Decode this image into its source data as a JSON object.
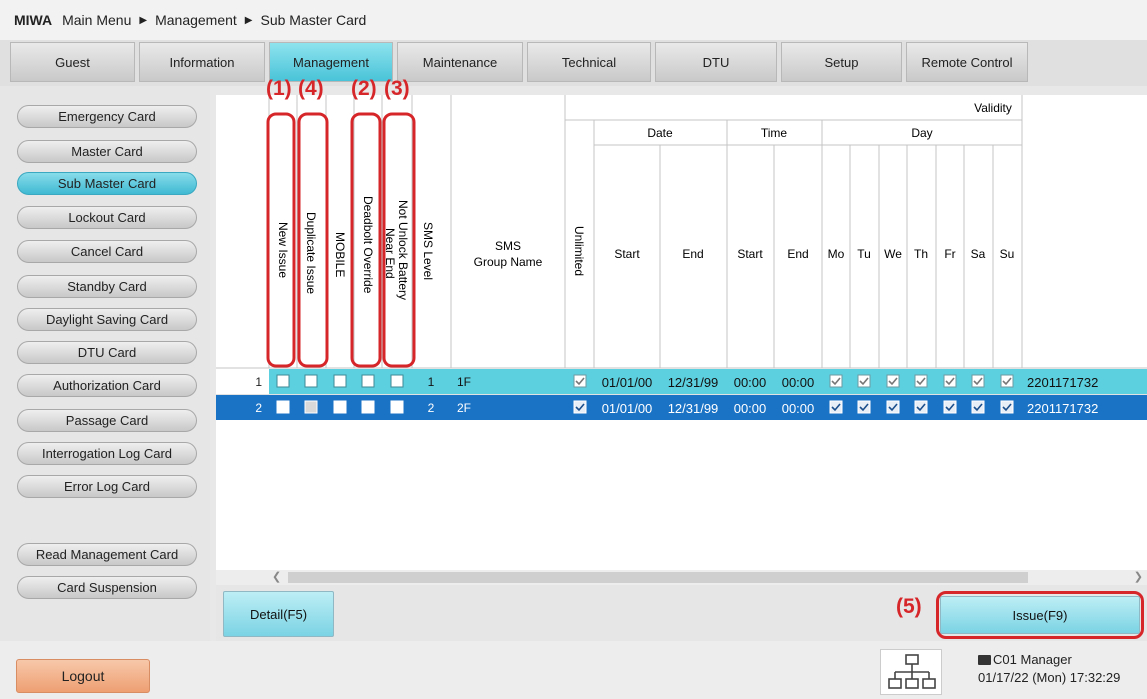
{
  "breadcrumb": {
    "brand": "MIWA",
    "items": [
      "Main Menu",
      "Management",
      "Sub Master Card"
    ]
  },
  "tabs": [
    {
      "label": "Guest",
      "active": false
    },
    {
      "label": "Information",
      "active": false
    },
    {
      "label": "Management",
      "active": true
    },
    {
      "label": "Maintenance",
      "active": false
    },
    {
      "label": "Technical",
      "active": false
    },
    {
      "label": "DTU",
      "active": false
    },
    {
      "label": "Setup",
      "active": false
    },
    {
      "label": "Remote Control",
      "active": false
    }
  ],
  "sidebar": {
    "items": [
      {
        "label": "Emergency Card",
        "active": false
      },
      {
        "label": "Master Card",
        "active": false
      },
      {
        "label": "Sub Master Card",
        "active": true
      },
      {
        "label": "Lockout Card",
        "active": false
      },
      {
        "label": "Cancel Card",
        "active": false
      },
      {
        "label": "Standby Card",
        "active": false
      },
      {
        "label": "Daylight Saving Card",
        "active": false
      },
      {
        "label": "DTU Card",
        "active": false
      },
      {
        "label": "Authorization Card",
        "active": false
      },
      {
        "label": "Passage Card",
        "active": false
      },
      {
        "label": "Interrogation Log Card",
        "active": false
      },
      {
        "label": "Error Log Card",
        "active": false
      },
      {
        "label": "Read Management Card",
        "active": false
      },
      {
        "label": "Card Suspension",
        "active": false
      }
    ]
  },
  "table": {
    "headers": {
      "new_issue": "New Issue",
      "duplicate_issue": "Duplicate Issue",
      "mobile": "MOBILE",
      "deadbolt_override": "Deadbolt Override",
      "not_unlock_battery": "Not Unlock Battery",
      "near_end": "Near End",
      "sms_level": "SMS Level",
      "sms_group_name_1": "SMS",
      "sms_group_name_2": "Group Name",
      "validity": "Validity",
      "unlimited": "Unlimited",
      "date": "Date",
      "time": "Time",
      "day": "Day",
      "start": "Start",
      "end": "End",
      "days": [
        "Mo",
        "Tu",
        "We",
        "Th",
        "Fr",
        "Sa",
        "Su"
      ]
    },
    "rows": [
      {
        "num": "1",
        "new_issue": false,
        "duplicate_issue": false,
        "mobile": false,
        "deadbolt_override": false,
        "not_unlock_battery": false,
        "level": "1",
        "group": "1F",
        "unlimited": true,
        "date_start": "01/01/00",
        "date_end": "12/31/99",
        "time_start": "00:00",
        "time_end": "00:00",
        "days": [
          true,
          true,
          true,
          true,
          true,
          true,
          true
        ],
        "id": "2201171732",
        "selected": false
      },
      {
        "num": "2",
        "new_issue": false,
        "duplicate_issue": false,
        "mobile": false,
        "deadbolt_override": false,
        "not_unlock_battery": false,
        "level": "2",
        "group": "2F",
        "unlimited": true,
        "date_start": "01/01/00",
        "date_end": "12/31/99",
        "time_start": "00:00",
        "time_end": "00:00",
        "days": [
          true,
          true,
          true,
          true,
          true,
          true,
          true
        ],
        "id": "2201171732",
        "selected": true
      }
    ]
  },
  "annotations": {
    "n1": "(1)",
    "n2": "(2)",
    "n3": "(3)",
    "n4": "(4)",
    "n5": "(5)",
    "color": "#d6262a"
  },
  "buttons": {
    "detail": "Detail(F5)",
    "issue": "Issue(F9)",
    "logout": "Logout"
  },
  "status": {
    "terminal": "C01",
    "user": "Manager",
    "datetime": "01/17/22 (Mon) 17:32:29"
  },
  "colors": {
    "accent": "#49c3d8",
    "row_highlight": "#5dd0df",
    "row_selected": "#1b73c6"
  }
}
